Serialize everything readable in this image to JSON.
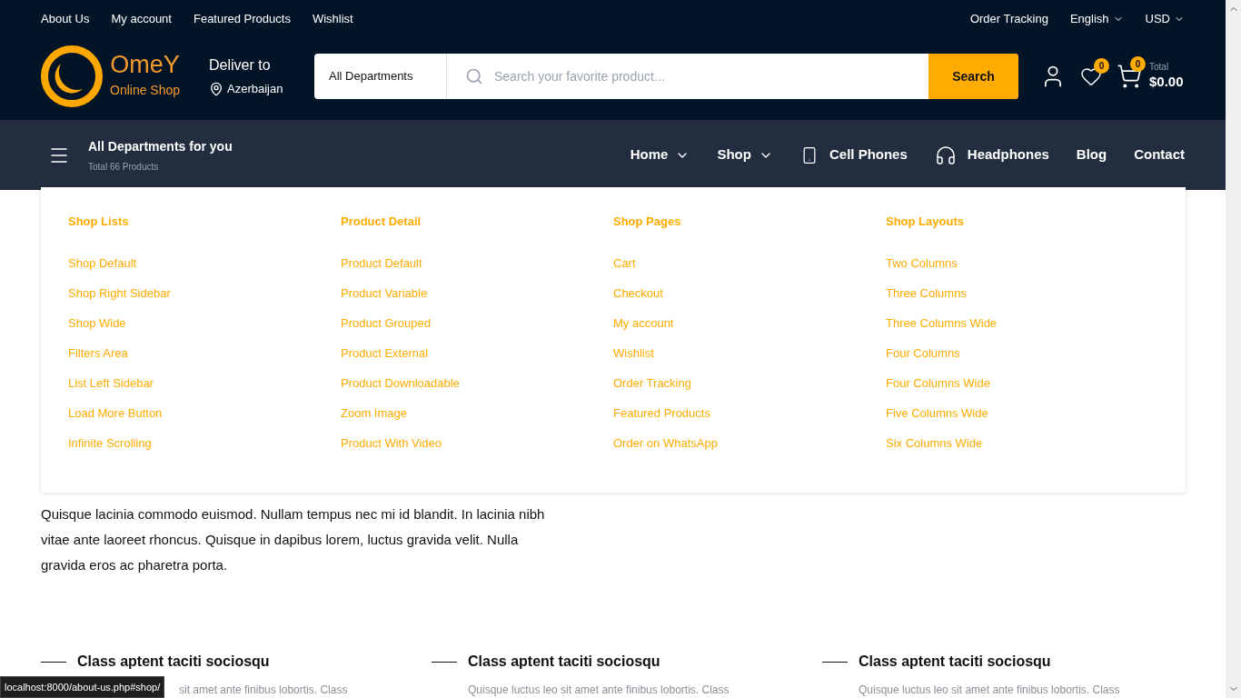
{
  "top_links": [
    "About Us",
    "My account",
    "Featured Products",
    "Wishlist"
  ],
  "top_right": {
    "tracking": "Order Tracking",
    "language": "English",
    "currency": "USD"
  },
  "logo": {
    "name": "OmeY",
    "tagline": "Online Shop"
  },
  "deliver": {
    "label": "Deliver to",
    "location": "Azerbaijan"
  },
  "search": {
    "department": "All Departments",
    "placeholder": "Search your favorite product...",
    "button": "Search"
  },
  "wishlist_count": "0",
  "cart": {
    "count": "0",
    "label": "Total",
    "total": "$0.00"
  },
  "departments": {
    "title": "All Departments for you",
    "subtitle": "Total 66 Products"
  },
  "nav": [
    {
      "label": "Home",
      "kind": "dropdown"
    },
    {
      "label": "Shop",
      "kind": "dropdown"
    },
    {
      "label": "Cell Phones",
      "kind": "phone"
    },
    {
      "label": "Headphones",
      "kind": "headphones"
    },
    {
      "label": "Blog",
      "kind": "plain"
    },
    {
      "label": "Contact",
      "kind": "plain"
    }
  ],
  "mega_menu": [
    {
      "title": "Shop Lists",
      "items": [
        "Shop Default",
        "Shop Right Sidebar",
        "Shop Wide",
        "Filters Area",
        "List Left Sidebar",
        "Load More Button",
        "Infinite Scrolling"
      ]
    },
    {
      "title": "Product Detail",
      "items": [
        "Product Default",
        "Product Variable",
        "Product Grouped",
        "Product External",
        "Product Downloadable",
        "Zoom Image",
        "Product With Video"
      ]
    },
    {
      "title": "Shop Pages",
      "items": [
        "Cart",
        "Checkout",
        "My account",
        "Wishlist",
        "Order Tracking",
        "Featured Products",
        "Order on WhatsApp"
      ]
    },
    {
      "title": "Shop Layouts",
      "items": [
        "Two Columns",
        "Three Columns",
        "Three Columns Wide",
        "Four Columns",
        "Four Columns Wide",
        "Five Columns Wide",
        "Six Columns Wide"
      ]
    }
  ],
  "paragraph": "Quisque lacinia commodo euismod. Nullam tempus nec mi id blandit. In lacinia nibh vitae ante laoreet rhoncus. Quisque in dapibus lorem, luctus gravida velit. Nulla gravida eros ac pharetra porta.",
  "features": [
    {
      "title": "Class aptent taciti sociosqu",
      "text": "sit amet ante finibus lobortis. Class"
    },
    {
      "title": "Class aptent taciti sociosqu",
      "text": "Quisque luctus leo sit amet ante finibus lobortis. Class"
    },
    {
      "title": "Class aptent taciti sociosqu",
      "text": "Quisque luctus leo sit amet ante finibus lobortis. Class"
    }
  ],
  "status_url": "localhost:8000/about-us.php#shop/"
}
